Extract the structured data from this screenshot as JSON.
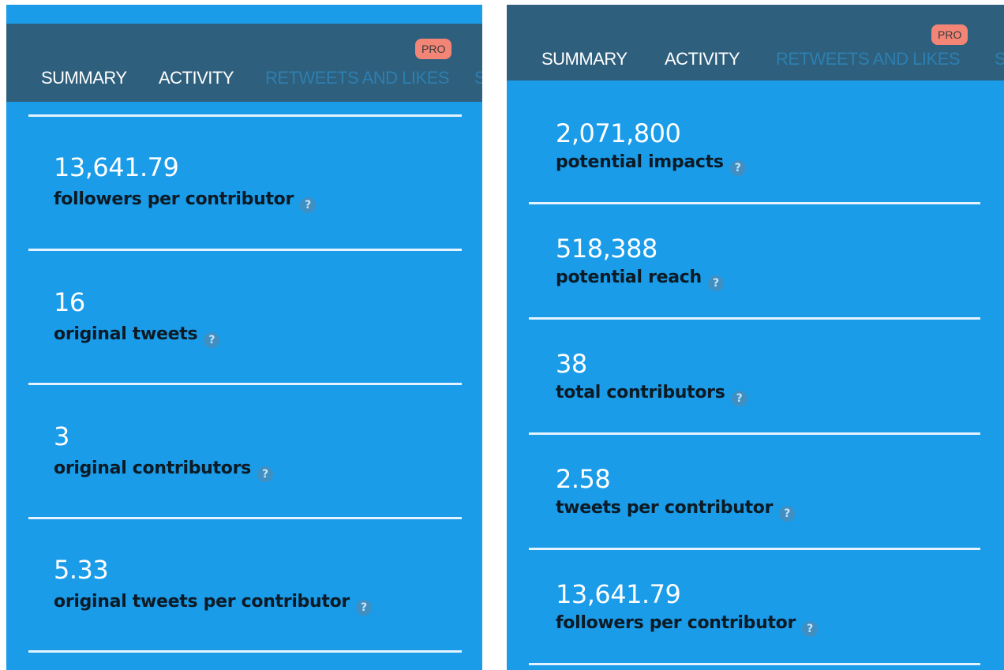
{
  "left_panel": {
    "tabs": [
      {
        "label": "SUMMARY"
      },
      {
        "label": "ACTIVITY"
      },
      {
        "label": "RETWEETS AND LIKES"
      },
      {
        "label": "S"
      }
    ],
    "pro_badge": "PRO",
    "stats": [
      {
        "value": "13,641.79",
        "label": "followers per contributor"
      },
      {
        "value": "16",
        "label": "original tweets"
      },
      {
        "value": "3",
        "label": "original contributors"
      },
      {
        "value": "5.33",
        "label": "original tweets per contributor"
      }
    ]
  },
  "right_panel": {
    "tabs": [
      {
        "label": "SUMMARY"
      },
      {
        "label": "ACTIVITY"
      },
      {
        "label": "RETWEETS AND LIKES"
      },
      {
        "label": "S"
      }
    ],
    "pro_badge": "PRO",
    "stats": [
      {
        "value": "2,071,800",
        "label": "potential impacts"
      },
      {
        "value": "518,388",
        "label": "potential reach"
      },
      {
        "value": "38",
        "label": "total contributors"
      },
      {
        "value": "2.58",
        "label": "tweets per contributor"
      },
      {
        "value": "13,641.79",
        "label": "followers per contributor"
      }
    ]
  },
  "help_icon_glyph": "?",
  "colors": {
    "panel_background": "#1a9ce9",
    "navbar_background": "#2e5f7d",
    "pro_badge": "#f38577",
    "divider": "#e4f3ff"
  }
}
